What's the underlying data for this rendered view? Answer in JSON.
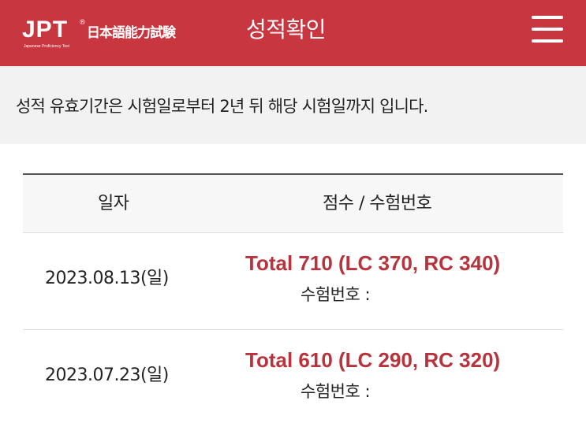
{
  "header": {
    "logo": {
      "brand": "JPT",
      "registered": "®",
      "japanese": "日本語能力試験",
      "subtitle": "Japanese Proficiency Test"
    },
    "title": "성적확인",
    "menu_icon": "hamburger-menu-icon"
  },
  "notice": {
    "text": "성적 유효기간은 시험일로부터 2년 뒤 해당 시험일까지 입니다."
  },
  "table": {
    "headers": {
      "date": "일자",
      "score": "점수 / 수험번호"
    },
    "rows": [
      {
        "date": "2023.08.13(일)",
        "score": "Total 710 (LC 370, RC 340)",
        "exam_label": "수험번호 :",
        "exam_number": ""
      },
      {
        "date": "2023.07.23(일)",
        "score": "Total 610 (LC 290, RC 320)",
        "exam_label": "수험번호 :",
        "exam_number": ""
      }
    ]
  },
  "colors": {
    "brand": "#c8363f",
    "score_text": "#b8333c",
    "notice_bg": "#f2f2f2"
  }
}
